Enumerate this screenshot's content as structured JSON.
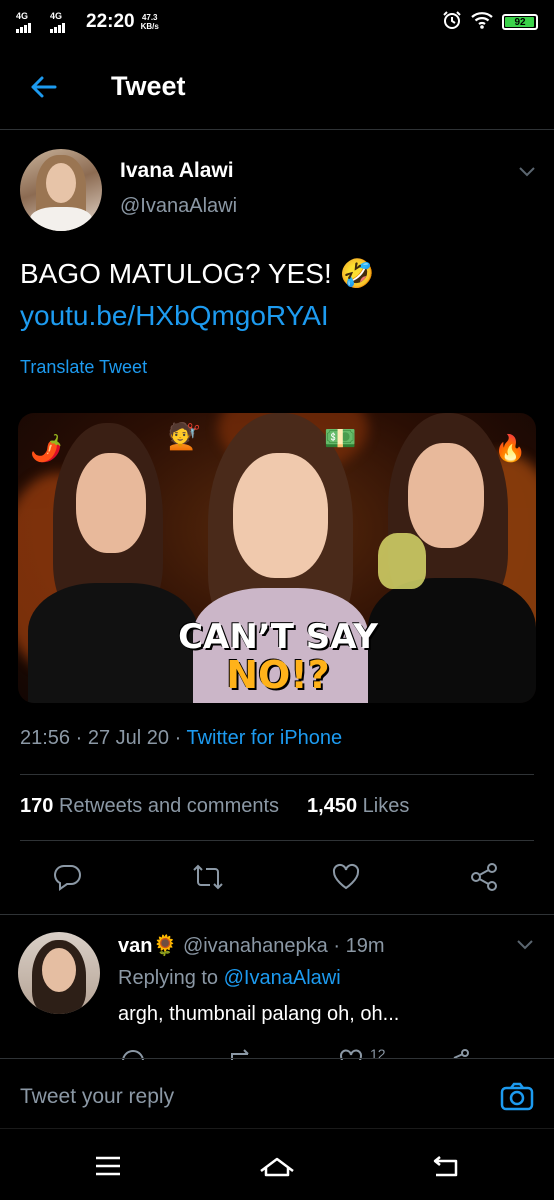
{
  "status_bar": {
    "signal1": "4G",
    "signal2": "4G",
    "time": "22:20",
    "speed_value": "47.3",
    "speed_unit": "KB/s",
    "battery": "92",
    "colors": {
      "battery_fill": "#3bd24a"
    }
  },
  "header": {
    "title": "Tweet"
  },
  "tweet": {
    "display_name": "Ivana Alawi",
    "handle": "@IvanaAlawi",
    "text": "BAGO MATULOG? YES! 🤣",
    "link": "youtu.be/HXbQmgoRYAI",
    "translate_label": "Translate Tweet",
    "thumbnail": {
      "line1": "CAN’T SAY",
      "line2": "NO!?"
    },
    "time": "21:56",
    "date": "27 Jul 20",
    "separator": "·",
    "source": "Twitter for iPhone",
    "retweets_count": "170",
    "retweets_label": "Retweets and comments",
    "likes_count": "1,450",
    "likes_label": "Likes",
    "actions": [
      "comment-icon",
      "retweet-icon",
      "like-icon",
      "share-icon"
    ]
  },
  "reply": {
    "display_name": "van🌻",
    "handle": "@ivanahanepka",
    "separator": "·",
    "age": "19m",
    "replying_prefix": "Replying to",
    "replying_to": "@IvanaAlawi",
    "text": "argh, thumbnail palang oh, oh...",
    "peek_count": "12"
  },
  "compose": {
    "placeholder": "Tweet your reply"
  },
  "colors": {
    "accent": "#1d9bf0",
    "muted": "#8b98a5",
    "background": "#000000",
    "divider": "#2f3336"
  }
}
